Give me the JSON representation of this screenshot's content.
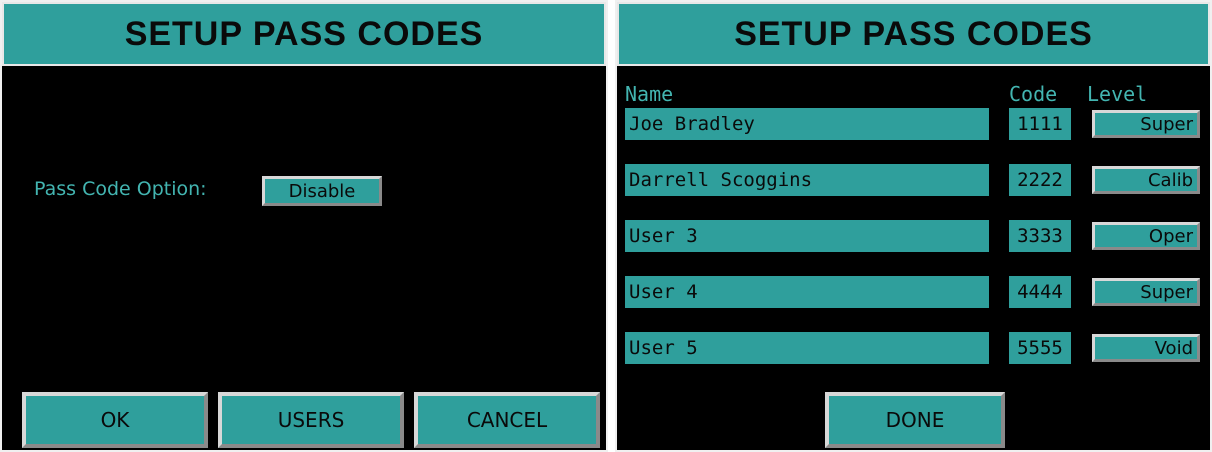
{
  "left": {
    "title": "SETUP PASS CODES",
    "pass_code_option_label": "Pass Code Option:",
    "pass_code_option_value": "Disable",
    "buttons": {
      "ok": "OK",
      "users": "USERS",
      "cancel": "CANCEL"
    }
  },
  "right": {
    "title": "SETUP PASS CODES",
    "headers": {
      "name": "Name",
      "code": "Code",
      "level": "Level"
    },
    "users": [
      {
        "name": "Joe Bradley",
        "code": "1111",
        "level": "Super"
      },
      {
        "name": "Darrell Scoggins",
        "code": "2222",
        "level": "Calib"
      },
      {
        "name": "User 3",
        "code": "3333",
        "level": "Oper"
      },
      {
        "name": "User 4",
        "code": "4444",
        "level": "Super"
      },
      {
        "name": "User 5",
        "code": "5555",
        "level": "Void"
      }
    ],
    "done_label": "DONE"
  },
  "colors": {
    "teal": "#2f9f9c",
    "label_teal": "#43b5b1",
    "background": "#000000"
  }
}
